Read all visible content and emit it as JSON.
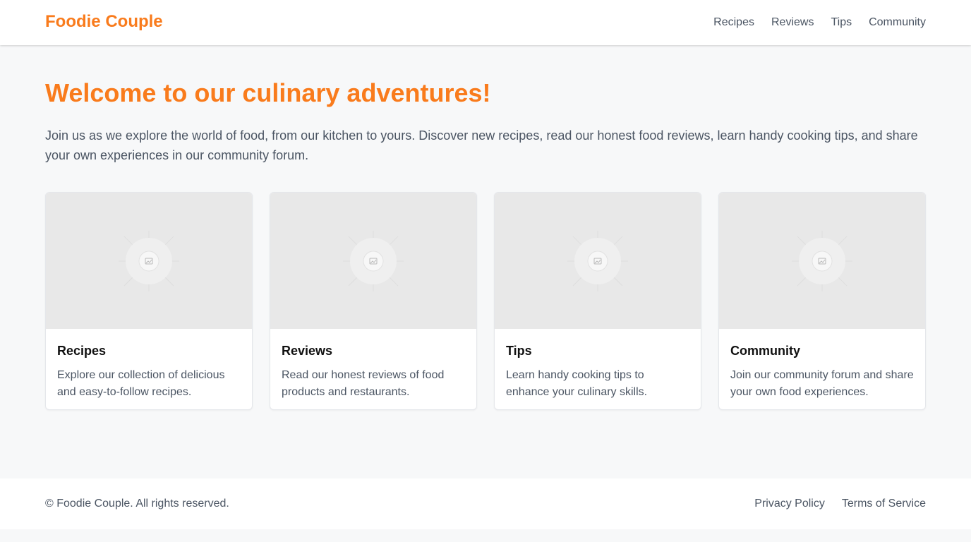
{
  "site": {
    "logo": "Foodie Couple",
    "brand_color": "#f97b1c"
  },
  "nav": {
    "items": [
      {
        "label": "Recipes"
      },
      {
        "label": "Reviews"
      },
      {
        "label": "Tips"
      },
      {
        "label": "Community"
      }
    ]
  },
  "hero": {
    "title": "Welcome to our culinary adventures!",
    "text": "Join us as we explore the world of food, from our kitchen to yours. Discover new recipes, read our honest food reviews, learn handy cooking tips, and share your own experiences in our community forum."
  },
  "cards": [
    {
      "title": "Recipes",
      "description": "Explore our collection of delicious and easy-to-follow recipes.",
      "image_icon": "image-placeholder-icon"
    },
    {
      "title": "Reviews",
      "description": "Read our honest reviews of food products and restaurants.",
      "image_icon": "image-placeholder-icon"
    },
    {
      "title": "Tips",
      "description": "Learn handy cooking tips to enhance your culinary skills.",
      "image_icon": "image-placeholder-icon"
    },
    {
      "title": "Community",
      "description": "Join our community forum and share your own food experiences.",
      "image_icon": "image-placeholder-icon"
    }
  ],
  "footer": {
    "copyright": "© Foodie Couple. All rights reserved.",
    "links": [
      {
        "label": "Privacy Policy"
      },
      {
        "label": "Terms of Service"
      }
    ]
  }
}
